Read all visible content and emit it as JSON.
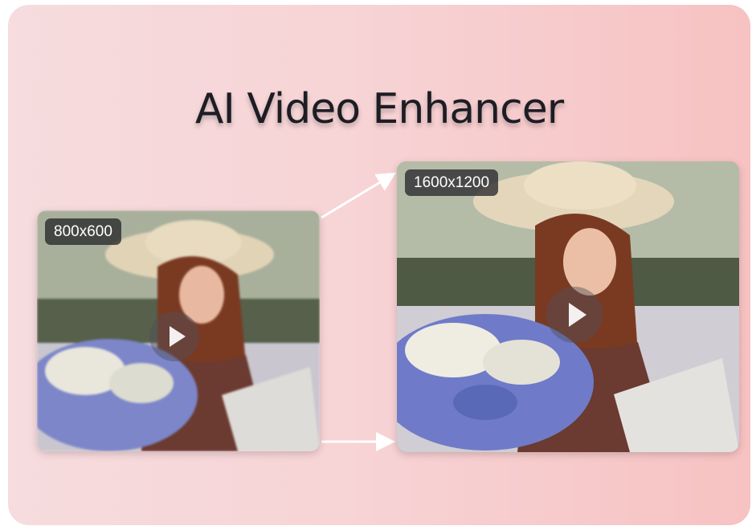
{
  "title": "AI Video Enhancer",
  "original_video": {
    "resolution": "800x600"
  },
  "enhanced_video": {
    "resolution": "1600x1200"
  },
  "colors": {
    "background_left": "#f6dcde",
    "background_right": "#f7c2c2",
    "title": "#1d1d24",
    "badge": "#28282c",
    "arrow": "#ffffff"
  }
}
